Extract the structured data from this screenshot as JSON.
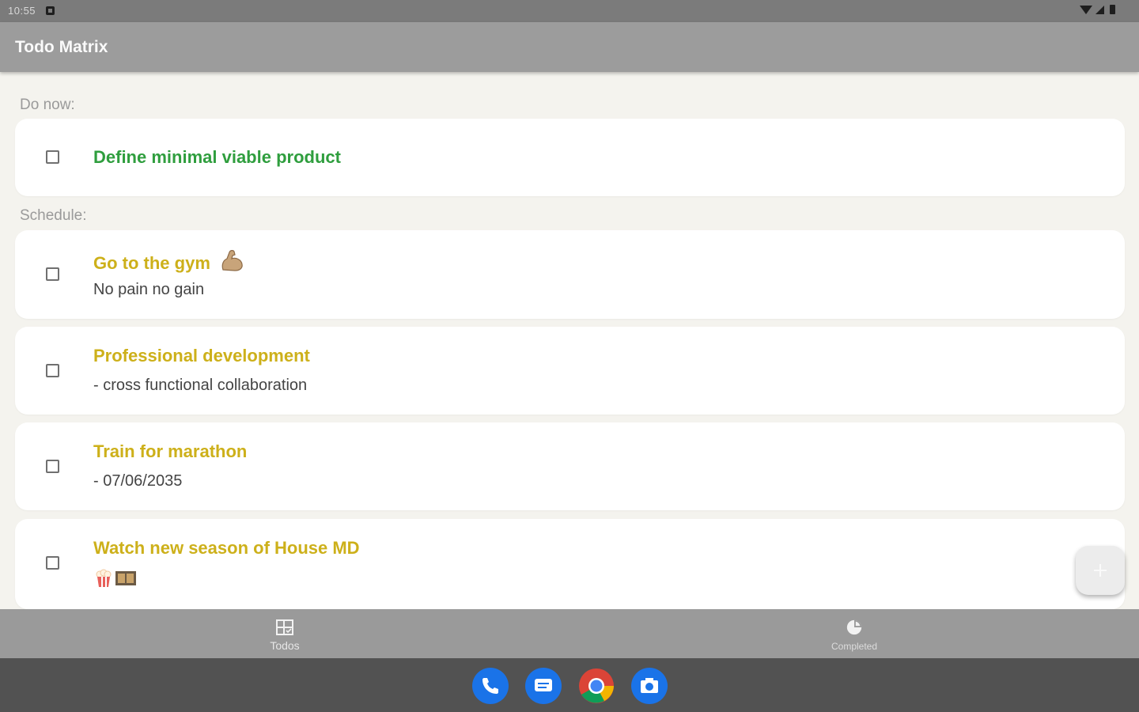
{
  "status_bar": {
    "time": "10:55"
  },
  "app_bar": {
    "title": "Todo Matrix"
  },
  "sections": {
    "do_now": {
      "label": "Do now:"
    },
    "schedule": {
      "label": "Schedule:"
    }
  },
  "tasks": [
    {
      "title": "Define minimal viable product",
      "description": "",
      "quadrant": "do_now",
      "completed": false
    },
    {
      "title": "Go to the gym",
      "emoji": "flexed-biceps-icon",
      "description": "No pain no gain",
      "quadrant": "schedule",
      "completed": false
    },
    {
      "title": "Professional development",
      "description": "- cross functional collaboration",
      "quadrant": "schedule",
      "completed": false
    },
    {
      "title": "Train for marathon",
      "description": "- 07/06/2035",
      "quadrant": "schedule",
      "completed": false
    },
    {
      "title": "Watch new season of House MD",
      "description_icons": [
        "popcorn-icon",
        "film-frames-icon"
      ],
      "quadrant": "schedule",
      "completed": false
    }
  ],
  "fab": {
    "icon": "plus-icon"
  },
  "bottom_nav": {
    "items": [
      {
        "label": "Todos",
        "icon": "todo-list-icon",
        "selected": true
      },
      {
        "label": "Completed",
        "icon": "pie-chart-icon",
        "selected": false
      }
    ]
  },
  "dock": {
    "apps": [
      "phone-icon",
      "messages-icon",
      "chrome-icon",
      "camera-icon"
    ]
  },
  "colors": {
    "do_now_title": "#2f9e3e",
    "schedule_title": "#cdb01a",
    "app_bar": "#9c9c9c",
    "background": "#f4f3ee"
  }
}
